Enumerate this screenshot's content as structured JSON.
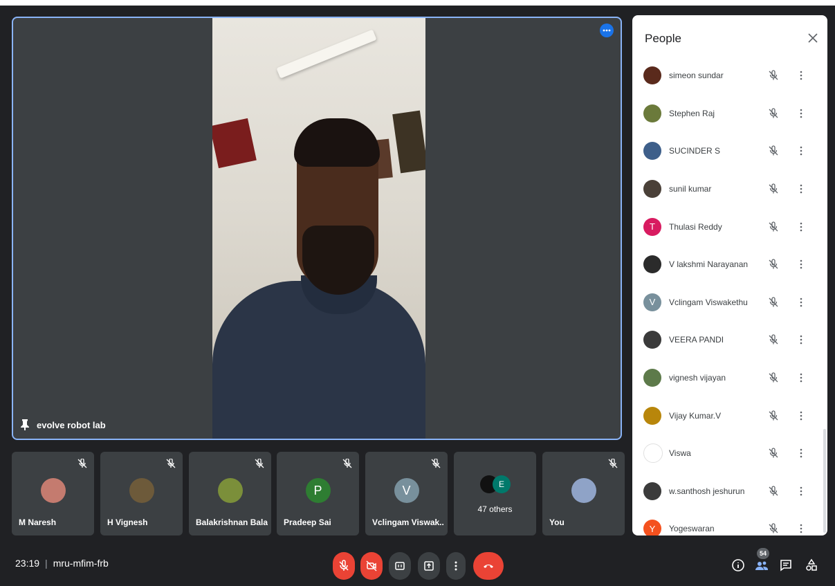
{
  "stage": {
    "pinned_name": "evolve robot lab"
  },
  "tiles": [
    {
      "name": "M Naresh",
      "avatar_color": "#c47b6f"
    },
    {
      "name": "H Vignesh",
      "avatar_color": "#6d5a3a"
    },
    {
      "name": "Balakrishnan Bala",
      "avatar_color": "#7b8f3a"
    },
    {
      "name": "Pradeep Sai",
      "initial": "P",
      "avatar_color": "#2e7d32"
    },
    {
      "name": "Vclingam Viswak...",
      "initial": "V",
      "avatar_color": "#78909c"
    },
    {
      "others_label": "47 others",
      "initial": "E",
      "avatar_color": "#00796b"
    },
    {
      "name": "You",
      "avatar_color": "#8fa3c7"
    }
  ],
  "meeting": {
    "time": "23:19",
    "code": "mru-mfim-frb",
    "participant_count": "54"
  },
  "people_panel": {
    "title": "People",
    "participants": [
      {
        "name": "simeon sundar",
        "avatar_color": "#5a2a1c"
      },
      {
        "name": "Stephen Raj",
        "avatar_color": "#6b7a3b"
      },
      {
        "name": "SUCINDER S",
        "avatar_color": "#3e5f8a"
      },
      {
        "name": "sunil kumar",
        "avatar_color": "#4a4038"
      },
      {
        "name": "Thulasi Reddy",
        "initial": "T",
        "avatar_color": "#d81b60"
      },
      {
        "name": "V lakshmi Narayanan",
        "avatar_color": "#2b2b2b"
      },
      {
        "name": "Vclingam Viswakethu",
        "initial": "V",
        "avatar_color": "#78909c"
      },
      {
        "name": "VEERA PANDI",
        "avatar_color": "#3a3a3a"
      },
      {
        "name": "vignesh vijayan",
        "avatar_color": "#5d7a4a"
      },
      {
        "name": "Vijay Kumar.V",
        "avatar_color": "#b8860b"
      },
      {
        "name": "Viswa",
        "avatar_color": "#ffffff"
      },
      {
        "name": "w.santhosh jeshurun",
        "avatar_color": "#3b3b3b"
      },
      {
        "name": "Yogeswaran",
        "initial": "Y",
        "avatar_color": "#f4511e"
      }
    ]
  },
  "colors": {
    "accent": "#1a73e8",
    "danger": "#ea4335",
    "tile_bg": "#3c4043",
    "page_bg": "#202124"
  }
}
